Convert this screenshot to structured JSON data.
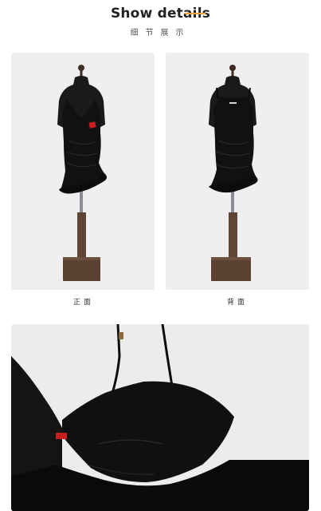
{
  "header": {
    "title": "Show details",
    "subtitle": "细节展示",
    "accent_color": "#f0a437"
  },
  "photos": [
    {
      "caption": "正面",
      "subject": "black mini dress on mannequin, front view"
    },
    {
      "caption": "背面",
      "subject": "black mini dress on mannequin, back view"
    },
    {
      "caption": "",
      "subject": "close-up of bust with spaghetti straps and red label"
    }
  ],
  "colors": {
    "background": "#ffffff",
    "card": "#efeff0",
    "fabric": "#111111",
    "stand": "#5e4535",
    "label": "#c81e1e"
  }
}
